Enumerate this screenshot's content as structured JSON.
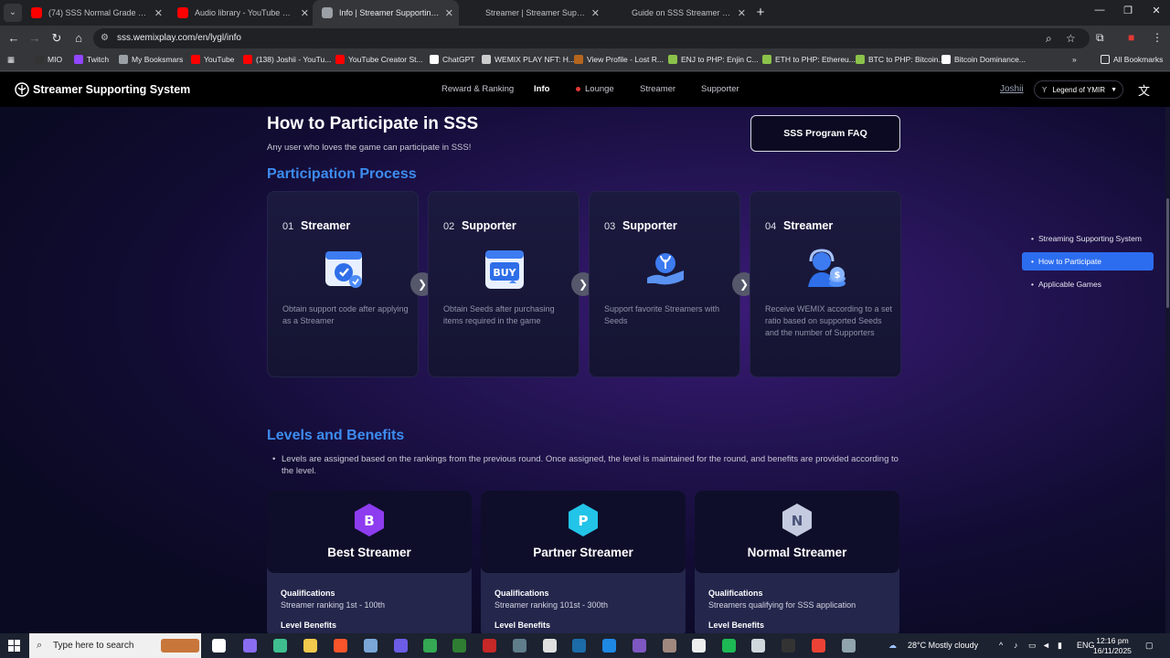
{
  "browser": {
    "tabs": [
      {
        "title": "(74) SSS Normal Grade Streame",
        "active": false,
        "favicon_color": "#ff0000"
      },
      {
        "title": "Audio library - YouTube Studio",
        "active": false,
        "favicon_color": "#ff0000"
      },
      {
        "title": "Info | Streamer Supporting Syst",
        "active": true,
        "favicon_color": "#9aa0a6"
      },
      {
        "title": "Streamer | Streamer Supporting",
        "active": false,
        "favicon_color": "#202124"
      },
      {
        "title": "Guide on SSS Streamer Mission",
        "active": false,
        "favicon_color": "#202124"
      }
    ],
    "new_tab": "+",
    "url": "sss.wemixplay.com/en/lygl/info",
    "bookmarks": [
      {
        "label": "MIO",
        "color": "#333333"
      },
      {
        "label": "Twitch",
        "color": "#9146ff"
      },
      {
        "label": "My Booksmars",
        "color": "#9aa0a6"
      },
      {
        "label": "YouTube",
        "color": "#ff0000"
      },
      {
        "label": "(138) Joshii - YouTu...",
        "color": "#ff0000"
      },
      {
        "label": "YouTube Creator St...",
        "color": "#ff0000"
      },
      {
        "label": "ChatGPT",
        "color": "#ffffff"
      },
      {
        "label": "WEMIX PLAY NFT: H...",
        "color": "#cccccc"
      },
      {
        "label": "View Profile - Lost R...",
        "color": "#b5651d"
      },
      {
        "label": "ENJ to PHP: Enjin C...",
        "color": "#8bc34a"
      },
      {
        "label": "ETH to PHP: Ethereu...",
        "color": "#8bc34a"
      },
      {
        "label": "BTC to PHP: Bitcoin...",
        "color": "#8bc34a"
      },
      {
        "label": "Bitcoin Dominance...",
        "color": "#ffffff"
      }
    ],
    "more_bookmarks": "»",
    "all_bookmarks": "All Bookmarks"
  },
  "site": {
    "logo": "Streamer Supporting System",
    "nav": [
      "Reward & Ranking",
      "Info",
      "Lounge",
      "Streamer",
      "Supporter"
    ],
    "active_nav": "Info",
    "user": "Joshii",
    "game_select": "Legend of YMIR"
  },
  "main": {
    "title": "How to Participate in SSS",
    "subtitle": "Any user who loves the game can participate in SSS!",
    "faq_button": "SSS Program FAQ",
    "process_heading": "Participation Process",
    "steps": [
      {
        "num": "01",
        "role": "Streamer",
        "desc": "Obtain support code after applying as a Streamer",
        "icon": "code-window-icon"
      },
      {
        "num": "02",
        "role": "Supporter",
        "desc": "Obtain Seeds after purchasing items required in the game",
        "icon": "buy-window-icon"
      },
      {
        "num": "03",
        "role": "Supporter",
        "desc": "Support favorite Streamers with Seeds",
        "icon": "hand-seed-icon"
      },
      {
        "num": "04",
        "role": "Streamer",
        "desc": "Receive WEMIX according to a set ratio based on supported Seeds and the number of Supporters",
        "icon": "streamer-coin-icon"
      }
    ],
    "levels_heading": "Levels and Benefits",
    "levels_note": "Levels are assigned based on the rankings from the previous round. Once assigned, the level is maintained for the round, and benefits are provided according to the level.",
    "levels": [
      {
        "badge": "B",
        "name": "Best Streamer",
        "qual_label": "Qualifications",
        "qual": "Streamer ranking 1st - 100th",
        "benefits_label": "Level Benefits",
        "color": "#8e3cf0"
      },
      {
        "badge": "P",
        "name": "Partner Streamer",
        "qual_label": "Qualifications",
        "qual": "Streamer ranking 101st - 300th",
        "benefits_label": "Level Benefits",
        "color": "#22c4e8"
      },
      {
        "badge": "N",
        "name": "Normal Streamer",
        "qual_label": "Qualifications",
        "qual": "Streamers qualifying for SSS application",
        "benefits_label": "Level Benefits",
        "color": "#c4cbe0"
      }
    ]
  },
  "side_nav": {
    "items": [
      "Streaming Supporting System",
      "How to Participate",
      "Applicable Games"
    ],
    "active": "How to Participate"
  },
  "taskbar": {
    "search_placeholder": "Type here to search",
    "weather": "28°C  Mostly cloudy",
    "lang": "ENG",
    "time": "12:16 pm",
    "date": "16/11/2025"
  }
}
